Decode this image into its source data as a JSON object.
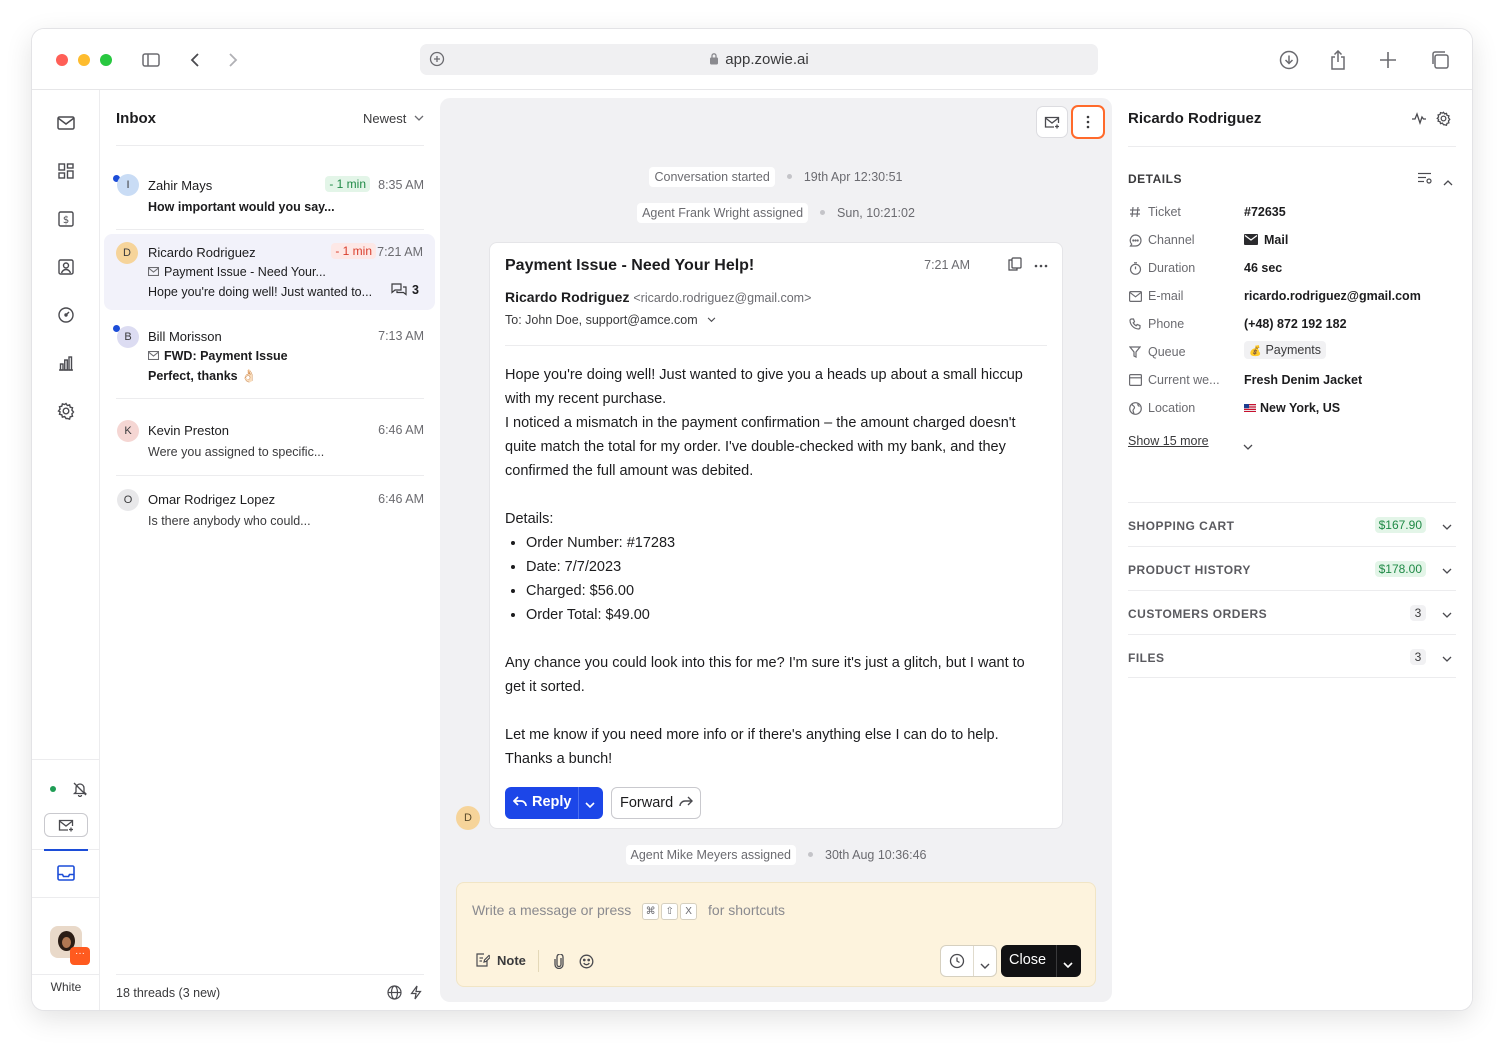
{
  "browser": {
    "url": "app.zowie.ai"
  },
  "rail": {
    "workspace_label": "White"
  },
  "inbox": {
    "title": "Inbox",
    "sort_label": "Newest",
    "threads": [
      {
        "initial": "I",
        "name": "Zahir Mays",
        "sla": "- 1 min",
        "time": "8:35 AM",
        "preview": "How important would you say...",
        "unread": true
      },
      {
        "initial": "D",
        "name": "Ricardo Rodriguez",
        "sla": "- 1 min",
        "time": "7:21 AM",
        "subject": "Payment Issue - Need Your...",
        "preview": "Hope you're doing well! Just wanted to...",
        "replies": "3"
      },
      {
        "initial": "B",
        "name": "Bill Morisson",
        "time": "7:13 AM",
        "subject": "FWD: Payment Issue",
        "preview": "Perfect, thanks 👌🏻",
        "unread": true
      },
      {
        "initial": "K",
        "name": "Kevin Preston",
        "time": "6:46 AM",
        "preview": "Were you assigned to specific..."
      },
      {
        "initial": "O",
        "name": "Omar Rodrigez Lopez",
        "time": "6:46 AM",
        "preview": "Is there anybody who could..."
      }
    ],
    "footer_count": "18 threads (3 new)"
  },
  "conversation": {
    "events": [
      {
        "text": "Conversation started",
        "time": "19th Apr 12:30:51"
      },
      {
        "text": "Agent Frank Wright assigned",
        "time": "Sun, 10:21:02"
      },
      {
        "text": "Agent Mike Meyers assigned",
        "time": "30th Aug 10:36:46"
      }
    ],
    "email": {
      "subject": "Payment Issue - Need Your Help!",
      "time": "7:21 AM",
      "from_name": "Ricardo Rodriguez",
      "from_email": "<ricardo.rodriguez@gmail.com>",
      "to": "To: John Doe, support@amce.com",
      "p1": "Hope you're doing well! Just wanted to give you a heads up about a small hiccup with my recent purchase.",
      "p2": "I noticed a mismatch in the payment confirmation – the amount charged doesn't quite match the total for my order. I've double-checked with my bank, and they confirmed the full amount was debited.",
      "details_label": "Details:",
      "items": [
        "Order Number: #17283",
        "Date: 7/7/2023",
        "Charged: $56.00",
        "Order Total: $49.00"
      ],
      "p3": "Any chance you could look into this for me? I'm sure it's just a glitch, but I want to get it sorted.",
      "p4": "Let me know if you need more info or if there's anything else I can do to help.",
      "p5": "Thanks a bunch!",
      "sender_initial": "D"
    },
    "reply_label": "Reply",
    "forward_label": "Forward",
    "composer": {
      "placeholder_start": "Write a message or press",
      "keys": [
        "⌘",
        "⇧",
        "X"
      ],
      "placeholder_end": "for shortcuts",
      "note_label": "Note",
      "close_label": "Close"
    }
  },
  "details": {
    "customer_name": "Ricardo Rodriguez",
    "section_title": "DETAILS",
    "rows": [
      {
        "label": "Ticket",
        "value": "#72635"
      },
      {
        "label": "Channel",
        "value": "Mail"
      },
      {
        "label": "Duration",
        "value": "46 sec"
      },
      {
        "label": "E-mail",
        "value": "ricardo.rodriguez@gmail.com"
      },
      {
        "label": "Phone",
        "value": "(+48) 872 192 182"
      },
      {
        "label": "Queue",
        "value": "Payments"
      },
      {
        "label": "Current we...",
        "value": "Fresh Denim Jacket"
      },
      {
        "label": "Location",
        "value": "New York, US"
      }
    ],
    "show_more": "Show 15 more",
    "sections": [
      {
        "title": "SHOPPING CART",
        "badge": "$167.90"
      },
      {
        "title": "PRODUCT HISTORY",
        "badge": "$178.00"
      },
      {
        "title": "CUSTOMERS ORDERS",
        "badge": "3"
      },
      {
        "title": "FILES",
        "badge": "3"
      }
    ]
  },
  "colors": {
    "primary": "#1c46e8",
    "accent_orange": "#ff6a2b",
    "composer_bg": "#fdf3dd",
    "sla_green": "#1f8a46",
    "sla_red": "#d93d2b"
  }
}
